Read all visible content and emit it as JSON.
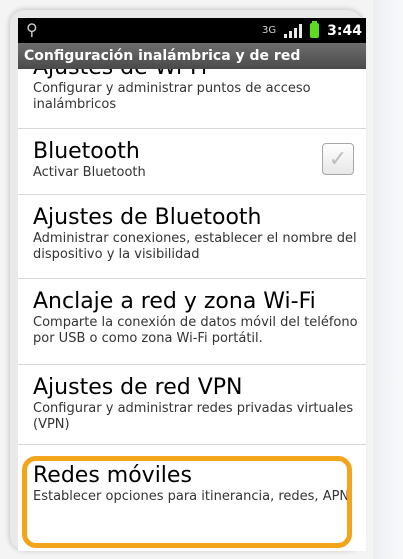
{
  "status_bar": {
    "time": "3:44",
    "network_type": "3G",
    "icons": [
      "usb-icon",
      "signal-icon",
      "battery-icon"
    ]
  },
  "header": {
    "title": "Configuración inalámbrica y de red"
  },
  "items": [
    {
      "title": "Ajustes de Wi-Fi",
      "summary": "Configurar y administrar puntos de acceso inalámbricos"
    },
    {
      "title": "Bluetooth",
      "summary": "Activar Bluetooth",
      "checkbox_checked": true
    },
    {
      "title": "Ajustes de Bluetooth",
      "summary": "Administrar conexiones, establecer el nombre del dispositivo y la visibilidad"
    },
    {
      "title": "Anclaje a red y zona Wi-Fi",
      "summary": "Comparte la conexión de datos móvil del teléfono por USB o como zona Wi-Fi portátil."
    },
    {
      "title": "Ajustes de red VPN",
      "summary": "Configurar y administrar redes privadas virtuales (VPN)"
    },
    {
      "title": "Redes móviles",
      "summary": "Establecer opciones para itinerancia, redes, APN"
    }
  ],
  "colors": {
    "highlight": "#f2a51a",
    "battery": "#5ddc1f"
  }
}
